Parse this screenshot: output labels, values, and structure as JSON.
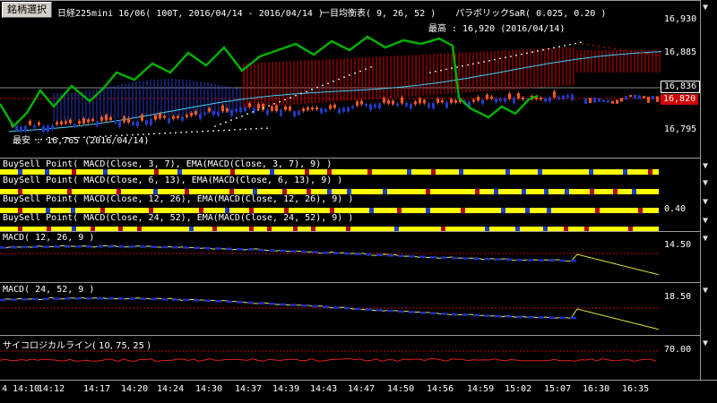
{
  "header": {
    "button_label": "銘柄選択",
    "title": "日経225mini 16/06( 100T, 2016/04/14 - 2016/04/14 )",
    "ichimoku": "一目均衡表( 9, 26, 52 )",
    "sar": "パラボリックSaR( 0.025, 0.20 )",
    "high_label": "最高 : 16,920 (2016/04/14)",
    "low_label": "最安 : 16,765 (2016/04/14)"
  },
  "price_axis": {
    "ticks": [
      "16,930",
      "16,885",
      "16,836",
      "16,820",
      "16,795"
    ],
    "current": "16,820",
    "boxed": "16,836"
  },
  "buysell": [
    {
      "label": "BuySell Point( MACD(Close, 3, 7), EMA(MACD(Close, 3, 7), 9) )"
    },
    {
      "label": "BuySell Point( MACD(Close, 6, 13), EMA(MACD(Close, 6, 13), 9) )"
    },
    {
      "label": "BuySell Point( MACD(Close, 12, 26), EMA(MACD(Close, 12, 26), 9) )"
    },
    {
      "label": "BuySell Point( MACD(Close, 24, 52), EMA(MACD(Close, 24, 52), 9) )"
    }
  ],
  "buysell_axis": "0.40",
  "macd1": {
    "label": "MACD( 12, 26, 9 )",
    "axis": "14.50"
  },
  "macd2": {
    "label": "MACD( 24, 52, 9 )",
    "axis": "18.50"
  },
  "psy": {
    "label": "サイコロジカルライン( 10, 75, 25 )",
    "axis": "70.00"
  },
  "x_axis": {
    "start": "4  14:10",
    "ticks": [
      "14:12",
      "14:17",
      "14:20",
      "14:24",
      "14:30",
      "14:37",
      "14:39",
      "14:43",
      "14:47",
      "14:50",
      "14:56",
      "14:59",
      "15:02",
      "15:07",
      "16:30",
      "16:35"
    ]
  },
  "colors": {
    "up": "#ff5a1e",
    "down": "#1e3cc8",
    "kumo_red": "#b40000",
    "kumo_blue": "#2030a0",
    "yellow": "#ffff00",
    "green": "#00b000",
    "chikou": "#00a000",
    "sar": "#ffffff",
    "kijun": "#40d0ff"
  }
}
